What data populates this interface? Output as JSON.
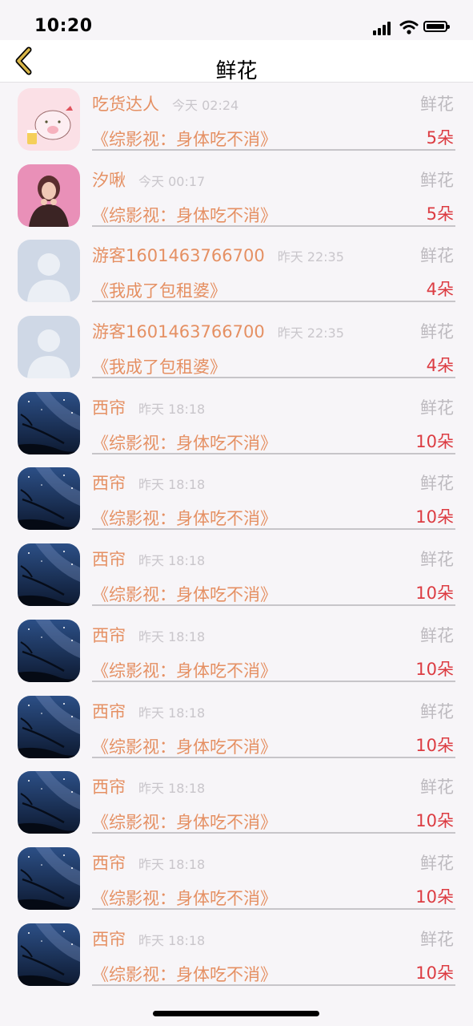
{
  "status_bar": {
    "time": "10:20"
  },
  "nav": {
    "title": "鲜花"
  },
  "items": [
    {
      "name": "吃货达人",
      "time": "今天 02:24",
      "type": "鲜花",
      "book": "《综影视：身体吃不消》",
      "count": "5朵",
      "avatar": "pig"
    },
    {
      "name": "汐啾",
      "time": "今天 00:17",
      "type": "鲜花",
      "book": "《综影视：身体吃不消》",
      "count": "5朵",
      "avatar": "girl"
    },
    {
      "name": "游客1601463766700",
      "time": "昨天 22:35",
      "type": "鲜花",
      "book": "《我成了包租婆》",
      "count": "4朵",
      "avatar": "default"
    },
    {
      "name": "游客1601463766700",
      "time": "昨天 22:35",
      "type": "鲜花",
      "book": "《我成了包租婆》",
      "count": "4朵",
      "avatar": "default"
    },
    {
      "name": "西帘",
      "time": "昨天 18:18",
      "type": "鲜花",
      "book": "《综影视：身体吃不消》",
      "count": "10朵",
      "avatar": "night"
    },
    {
      "name": "西帘",
      "time": "昨天 18:18",
      "type": "鲜花",
      "book": "《综影视：身体吃不消》",
      "count": "10朵",
      "avatar": "night"
    },
    {
      "name": "西帘",
      "time": "昨天 18:18",
      "type": "鲜花",
      "book": "《综影视：身体吃不消》",
      "count": "10朵",
      "avatar": "night"
    },
    {
      "name": "西帘",
      "time": "昨天 18:18",
      "type": "鲜花",
      "book": "《综影视：身体吃不消》",
      "count": "10朵",
      "avatar": "night"
    },
    {
      "name": "西帘",
      "time": "昨天 18:18",
      "type": "鲜花",
      "book": "《综影视：身体吃不消》",
      "count": "10朵",
      "avatar": "night"
    },
    {
      "name": "西帘",
      "time": "昨天 18:18",
      "type": "鲜花",
      "book": "《综影视：身体吃不消》",
      "count": "10朵",
      "avatar": "night"
    },
    {
      "name": "西帘",
      "time": "昨天 18:18",
      "type": "鲜花",
      "book": "《综影视：身体吃不消》",
      "count": "10朵",
      "avatar": "night"
    },
    {
      "name": "西帘",
      "time": "昨天 18:18",
      "type": "鲜花",
      "book": "《综影视：身体吃不消》",
      "count": "10朵",
      "avatar": "night"
    }
  ]
}
